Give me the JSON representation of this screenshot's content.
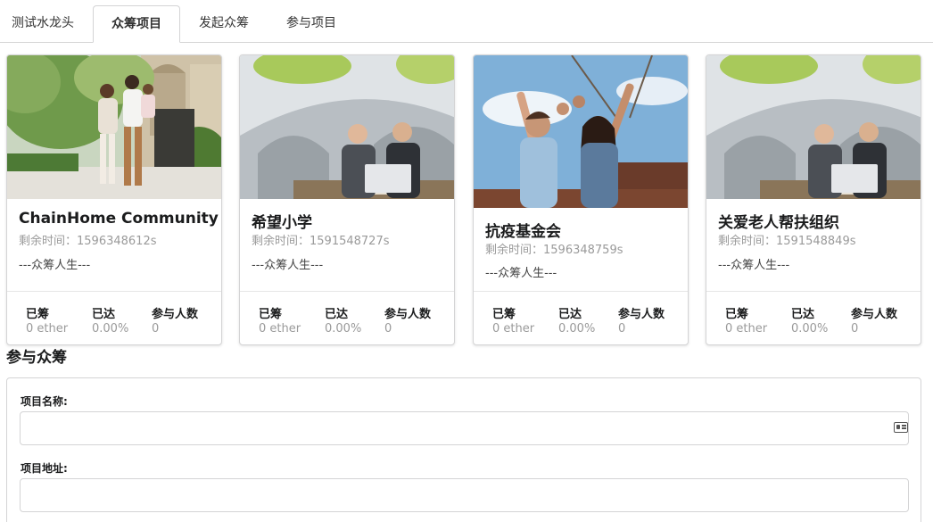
{
  "tabs": [
    {
      "label": "测试水龙头",
      "active": false
    },
    {
      "label": "众筹项目",
      "active": true
    },
    {
      "label": "发起众筹",
      "active": false
    },
    {
      "label": "参与项目",
      "active": false
    }
  ],
  "cards": [
    {
      "title": "ChainHome Community",
      "time_label": "剩余时间：",
      "time_value": "1596348612s",
      "desc": "---众筹人生---",
      "stats": [
        {
          "label": "已筹",
          "value": "0 ether"
        },
        {
          "label": "已达",
          "value": "0.00%"
        },
        {
          "label": "参与人数",
          "value": "0"
        }
      ]
    },
    {
      "title": "希望小学",
      "time_label": "剩余时间：",
      "time_value": "1591548727s",
      "desc": "---众筹人生---",
      "stats": [
        {
          "label": "已筹",
          "value": "0 ether"
        },
        {
          "label": "已达",
          "value": "0.00%"
        },
        {
          "label": "参与人数",
          "value": "0"
        }
      ]
    },
    {
      "title": "抗疫基金会",
      "time_label": "剩余时间：",
      "time_value": "1596348759s",
      "desc": "---众筹人生---",
      "stats": [
        {
          "label": "已筹",
          "value": "0 ether"
        },
        {
          "label": "已达",
          "value": "0.00%"
        },
        {
          "label": "参与人数",
          "value": "0"
        }
      ]
    },
    {
      "title": "关爱老人帮扶组织",
      "time_label": "剩余时间：",
      "time_value": "1591548849s",
      "desc": "---众筹人生---",
      "stats": [
        {
          "label": "已筹",
          "value": "0 ether"
        },
        {
          "label": "已达",
          "value": "0.00%"
        },
        {
          "label": "参与人数",
          "value": "0"
        }
      ]
    }
  ],
  "participate": {
    "title": "参与众筹",
    "name_label": "项目名称:",
    "name_value": "",
    "address_label": "项目地址:",
    "address_value": ""
  }
}
